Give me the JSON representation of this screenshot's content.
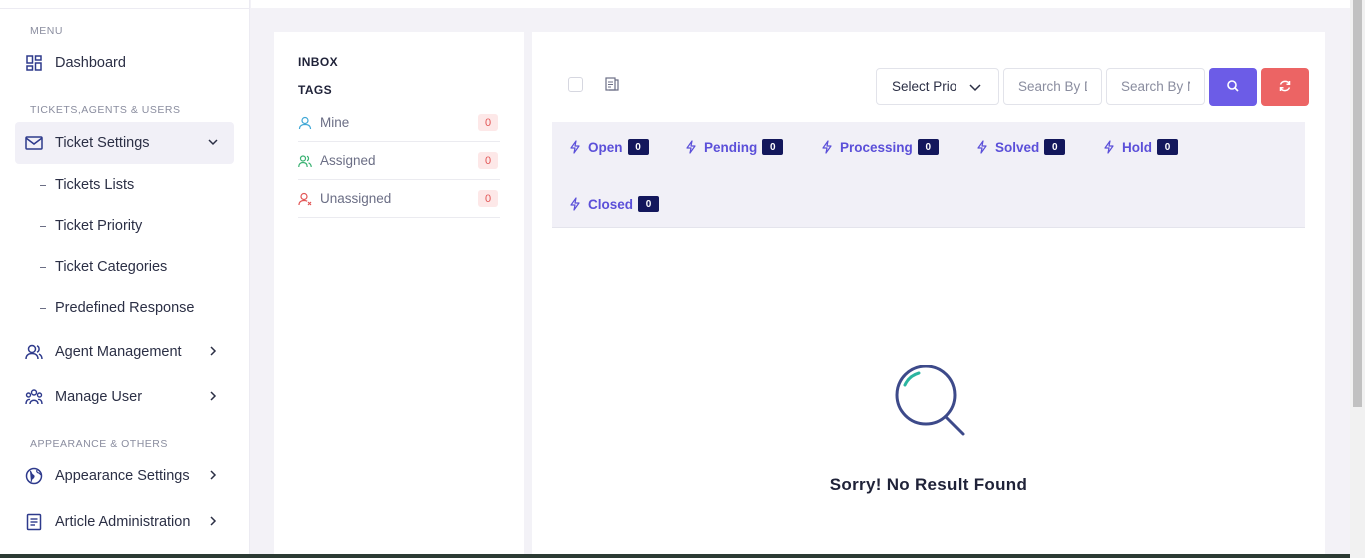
{
  "sidebar": {
    "sections": {
      "menu": "MENU",
      "tickets": "TICKETS,AGENTS & USERS",
      "appearance": "APPEARANCE & OTHERS"
    },
    "items": {
      "dashboard": "Dashboard",
      "ticket_settings": "Ticket Settings",
      "agent_management": "Agent Management",
      "manage_user": "Manage User",
      "appearance_settings": "Appearance Settings",
      "article_administration": "Article Administration"
    },
    "sub_items": [
      "Tickets Lists",
      "Ticket Priority",
      "Ticket Categories",
      "Predefined Response"
    ]
  },
  "inbox": {
    "title": "INBOX",
    "tags_title": "TAGS",
    "tags": [
      {
        "label": "Mine",
        "count": "0"
      },
      {
        "label": "Assigned",
        "count": "0"
      },
      {
        "label": "Unassigned",
        "count": "0"
      }
    ]
  },
  "toolbar": {
    "priority_select": "Select Priority",
    "search_1_placeholder": "Search By Date",
    "search_2_placeholder": "Search By Name"
  },
  "statuses": [
    {
      "label": "Open",
      "count": "0"
    },
    {
      "label": "Pending",
      "count": "0"
    },
    {
      "label": "Processing",
      "count": "0"
    },
    {
      "label": "Solved",
      "count": "0"
    },
    {
      "label": "Hold",
      "count": "0"
    },
    {
      "label": "Closed",
      "count": "0"
    }
  ],
  "empty": {
    "message": "Sorry! No Result Found"
  },
  "colors": {
    "accent": "#6c5ce7",
    "danger": "#ec6464",
    "badge": "#13175c"
  }
}
